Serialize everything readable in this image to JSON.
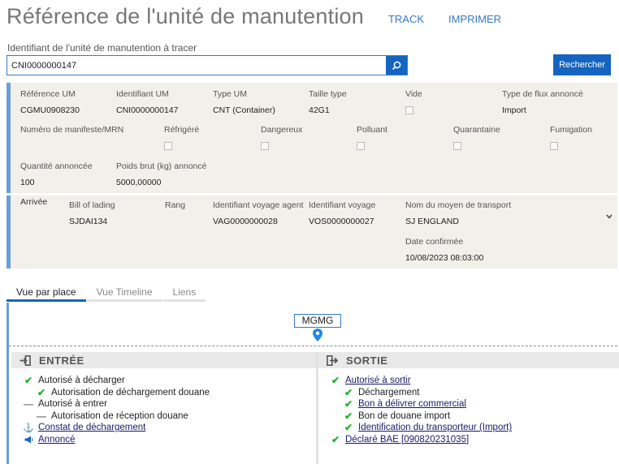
{
  "header": {
    "title": "Référence de l'unité de manutention",
    "links": [
      "TRACK",
      "IMPRIMER"
    ]
  },
  "search": {
    "label": "Identifiant de l'unité de manutention à tracer",
    "value": "CNI0000000147",
    "button": "Rechercher"
  },
  "details": {
    "row1": [
      {
        "label": "Référence UM",
        "value": "CGMU0908230"
      },
      {
        "label": "Identifiant UM",
        "value": "CNI0000000147"
      },
      {
        "label": "Type UM",
        "value": "CNT (Container)"
      },
      {
        "label": "Taille type",
        "value": "42G1"
      },
      {
        "label": "Vide",
        "value": ""
      },
      {
        "label": "Type de flux annoncé",
        "value": "Import"
      }
    ],
    "row2": [
      {
        "label": "Numéro de manifeste/MRN"
      },
      {
        "label": "Réfrigéré"
      },
      {
        "label": "Dangereux"
      },
      {
        "label": "Polluant"
      },
      {
        "label": "Quarantaine"
      },
      {
        "label": "Fumigation"
      }
    ],
    "row3": [
      {
        "label": "Quantité annoncée",
        "value": "100"
      },
      {
        "label": "Poids brut (kg) annoncé",
        "value": "5000,00000"
      }
    ]
  },
  "arrival": {
    "title": "Arrivée",
    "fields": [
      {
        "label": "Bill of lading",
        "value": "SJDAI134"
      },
      {
        "label": "Rang",
        "value": ""
      },
      {
        "label": "Identifiant voyage agent",
        "value": "VAG0000000028"
      },
      {
        "label": "Identifiant voyage",
        "value": "VOS0000000027"
      },
      {
        "label": "Nom du moyen de transport",
        "value": "SJ ENGLAND"
      }
    ],
    "confirmed_label": "Date confirmée",
    "confirmed_value": "10/08/2023 08:03:00"
  },
  "tabs": [
    "Vue par place",
    "Vue Timeline",
    "Liens"
  ],
  "place": "MGMG",
  "entree": {
    "title": "ENTRÉE",
    "items": [
      {
        "text": "Autorisé à décharger",
        "icon": "check",
        "level": 0,
        "link": false
      },
      {
        "text": "Autorisation de déchargement douane",
        "icon": "check",
        "level": 1,
        "link": false
      },
      {
        "text": "Autorisé à entrer",
        "icon": "dash",
        "level": 0,
        "link": false
      },
      {
        "text": "Autorisation de réception douane",
        "icon": "dash",
        "level": 1,
        "link": false
      },
      {
        "text": "Constat de déchargement",
        "icon": "anchor",
        "level": 0,
        "link": true
      },
      {
        "text": "Annoncé",
        "icon": "megaphone",
        "level": 0,
        "link": true
      }
    ]
  },
  "sortie": {
    "title": "SORTIE",
    "items": [
      {
        "text": "Autorisé à sortir",
        "icon": "check",
        "level": 0,
        "link": true
      },
      {
        "text": "Déchargement",
        "icon": "check",
        "level": 1,
        "link": false
      },
      {
        "text": "Bon à délivrer commercial",
        "icon": "check",
        "level": 1,
        "link": true
      },
      {
        "text": "Bon de douane import",
        "icon": "check",
        "level": 1,
        "link": false
      },
      {
        "text": "Identification du transporteur (Import)",
        "icon": "check",
        "level": 1,
        "link": true
      },
      {
        "text": "Déclaré BAE [090820231035]",
        "icon": "check",
        "level": 0,
        "link": true
      }
    ]
  }
}
